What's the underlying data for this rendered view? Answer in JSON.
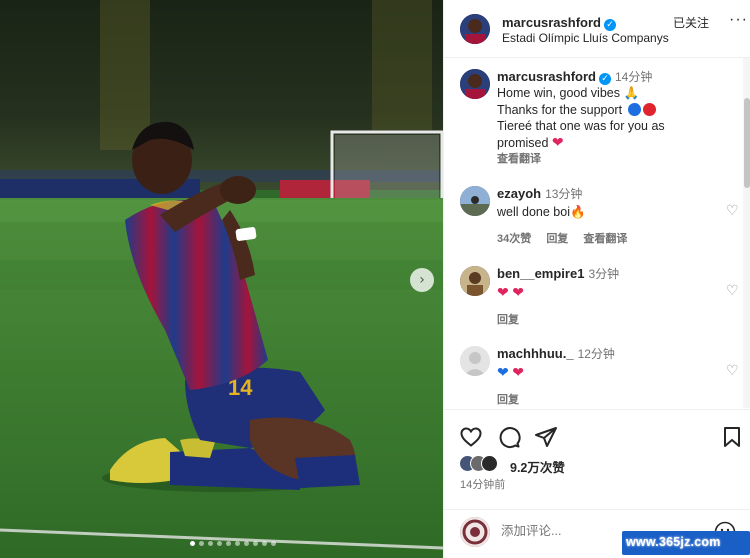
{
  "post": {
    "username": "marcusrashford",
    "location": "Estadi Olímpic Lluís Companys",
    "follow_label": "已关注",
    "more_label": "···"
  },
  "caption": {
    "username": "marcusrashford",
    "time": "14分钟",
    "line1": "Home win, good vibes",
    "line2": "Thanks for the support",
    "line3": "Tiereé that one was for you as",
    "line4": "promised",
    "translate": "查看翻译"
  },
  "comments": [
    {
      "username": "ezayoh",
      "time": "13分钟",
      "text": "well done boi",
      "likes": "34次赞",
      "reply": "回复",
      "translate": "查看翻译"
    },
    {
      "username": "ben__empire1",
      "time": "3分钟",
      "text": "",
      "reply": "回复"
    },
    {
      "username": "machhhuu._",
      "time": "12分钟",
      "text": "",
      "reply": "回复"
    }
  ],
  "actions": {
    "likes": "9.2万次赞",
    "posted": "14分钟前"
  },
  "add_comment": {
    "placeholder": "添加评论..."
  },
  "watermark": "www.365jz.com",
  "icons": {
    "like": "heart-outline-icon",
    "comment": "comment-bubble-icon",
    "share": "paper-plane-icon",
    "save": "bookmark-icon",
    "emoji": "smiley-icon",
    "carousel_next": "chevron-right-icon",
    "verified": "verified-badge-icon"
  },
  "colors": {
    "verified": "#0095f6",
    "heart": "#e0245e",
    "jersey_blue": "#1f3b8a",
    "jersey_red": "#a4143b"
  }
}
